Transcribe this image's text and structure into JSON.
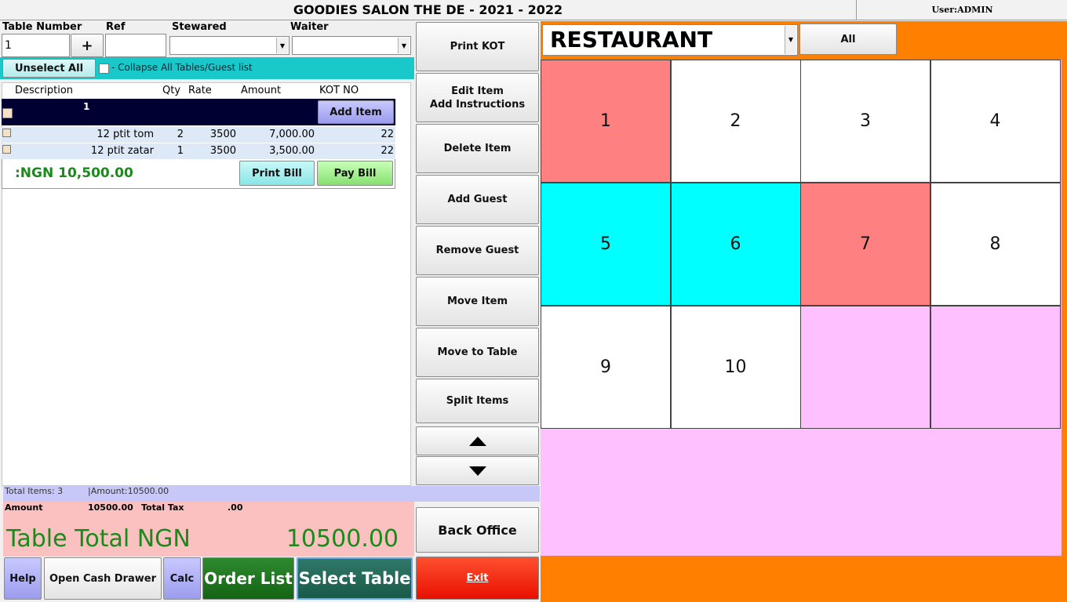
{
  "header": {
    "title": "GOODIES SALON THE DE - 2021 - 2022",
    "user": "User:ADMIN"
  },
  "form": {
    "table_number_label": "Table Number",
    "table_number_value": "1",
    "plus_label": "+",
    "ref_label": "Ref",
    "ref_value": "",
    "stewared_label": "Stewared",
    "waiter_label": "Waiter"
  },
  "selection": {
    "unselect_all_label": "Unselect All",
    "collapse_label": "- Collapse All Tables/Guest list"
  },
  "order": {
    "columns": {
      "description": "Description",
      "qty": "Qty",
      "rate": "Rate",
      "amount": "Amount",
      "kot_no": "KOT NO"
    },
    "guest_number": "1",
    "add_item_label": "Add Item",
    "items": [
      {
        "description": "12 ptit tom",
        "qty": "2",
        "rate": "3500",
        "amount": "7,000.00",
        "kot": "22"
      },
      {
        "description": "12 ptit zatar",
        "qty": "1",
        "rate": "3500",
        "amount": "3,500.00",
        "kot": "22"
      }
    ],
    "total": ":NGN 10,500.00",
    "print_bill_label": "Print Bill",
    "pay_bill_label": "Pay Bill"
  },
  "summary": {
    "total_items": "Total Items: 3",
    "amount_line": "|Amount:10500.00",
    "amount_label": "Amount",
    "amount_value": "10500.00",
    "tax_label": "Total Tax",
    "tax_value": ".00",
    "table_total_label": "Table Total NGN",
    "table_total_value": "10500.00"
  },
  "commands": {
    "print_kot": "Print KOT",
    "edit_item": "Edit Item",
    "add_instructions": "Add Instructions",
    "delete_item": "Delete Item",
    "add_guest": "Add Guest",
    "remove_guest": "Remove Guest",
    "move_item": "Move Item",
    "move_to_table": "Move to Table",
    "split_items": "Split Items",
    "back_office": "Back Office",
    "exit": "Exit"
  },
  "bottom_bar": {
    "help": "Help",
    "open_cash_drawer": "Open Cash Drawer",
    "calc": "Calc",
    "order_list": "Order List",
    "select_table": "Select Table"
  },
  "tables": {
    "area": "RESTAURANT",
    "filter_label": "All",
    "cells": [
      {
        "label": "1",
        "color": "#ff8080"
      },
      {
        "label": "2",
        "color": "#ffffff"
      },
      {
        "label": "3",
        "color": "#ffffff"
      },
      {
        "label": "4",
        "color": "#ffffff"
      },
      {
        "label": "5",
        "color": "#00ffff"
      },
      {
        "label": "6",
        "color": "#00ffff"
      },
      {
        "label": "7",
        "color": "#ff8080"
      },
      {
        "label": "8",
        "color": "#ffffff"
      },
      {
        "label": "9",
        "color": "#ffffff"
      },
      {
        "label": "10",
        "color": "#ffffff"
      },
      {
        "label": "",
        "color": "#ffc0ff"
      },
      {
        "label": "",
        "color": "#ffc0ff"
      }
    ]
  },
  "colors": {
    "orange": "#ff8000",
    "pink": "#ffc0ff",
    "cyan_bar": "#19c9c9",
    "green_total": "#1a8a1a",
    "exit_red": "#ff2000"
  }
}
